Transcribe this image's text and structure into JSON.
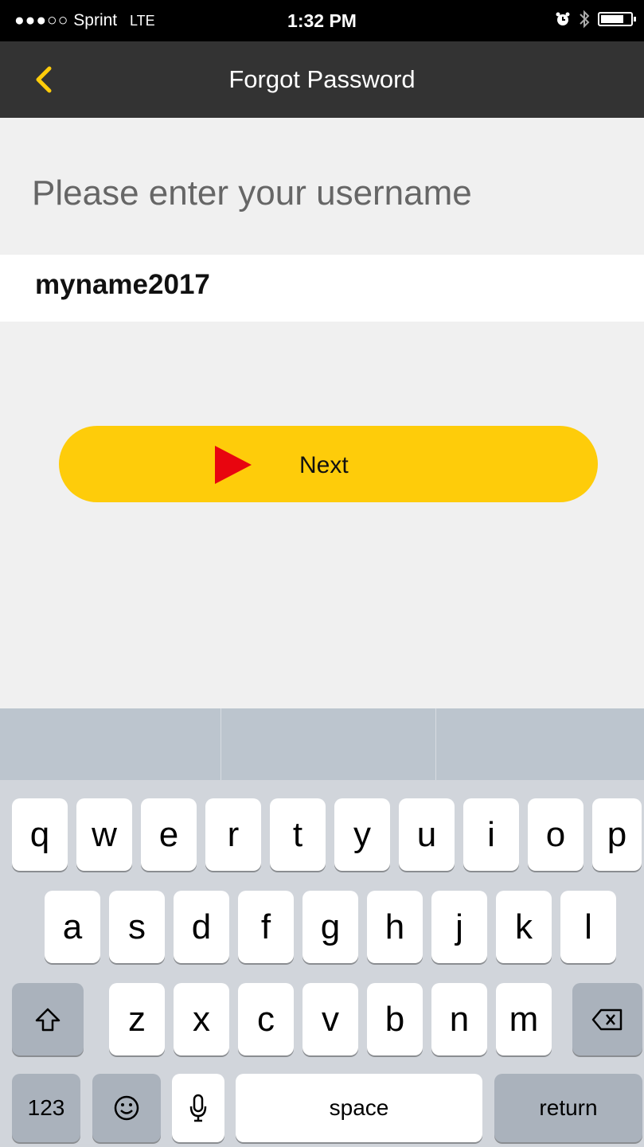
{
  "status_bar": {
    "signal": "●●●○○",
    "carrier": "Sprint",
    "network": "LTE",
    "time": "1:32 PM",
    "icons": [
      "alarm-icon",
      "bluetooth-icon",
      "battery-icon"
    ]
  },
  "nav": {
    "title": "Forgot Password",
    "back_icon": "chevron-left-icon",
    "accent": "#fecc0a"
  },
  "form": {
    "prompt": "Please enter your username",
    "username_value": "myname2017"
  },
  "next_button": {
    "label": "Next",
    "icon": "play-triangle-icon",
    "color": "#fecc0a",
    "icon_color": "#e8050f"
  },
  "keyboard": {
    "row1": [
      "q",
      "w",
      "e",
      "r",
      "t",
      "y",
      "u",
      "i",
      "o",
      "p"
    ],
    "row2": [
      "a",
      "s",
      "d",
      "f",
      "g",
      "h",
      "j",
      "k",
      "l"
    ],
    "row3": [
      "z",
      "x",
      "c",
      "v",
      "b",
      "n",
      "m"
    ],
    "numbers_key": "123",
    "space_key": "space",
    "return_key": "return"
  }
}
